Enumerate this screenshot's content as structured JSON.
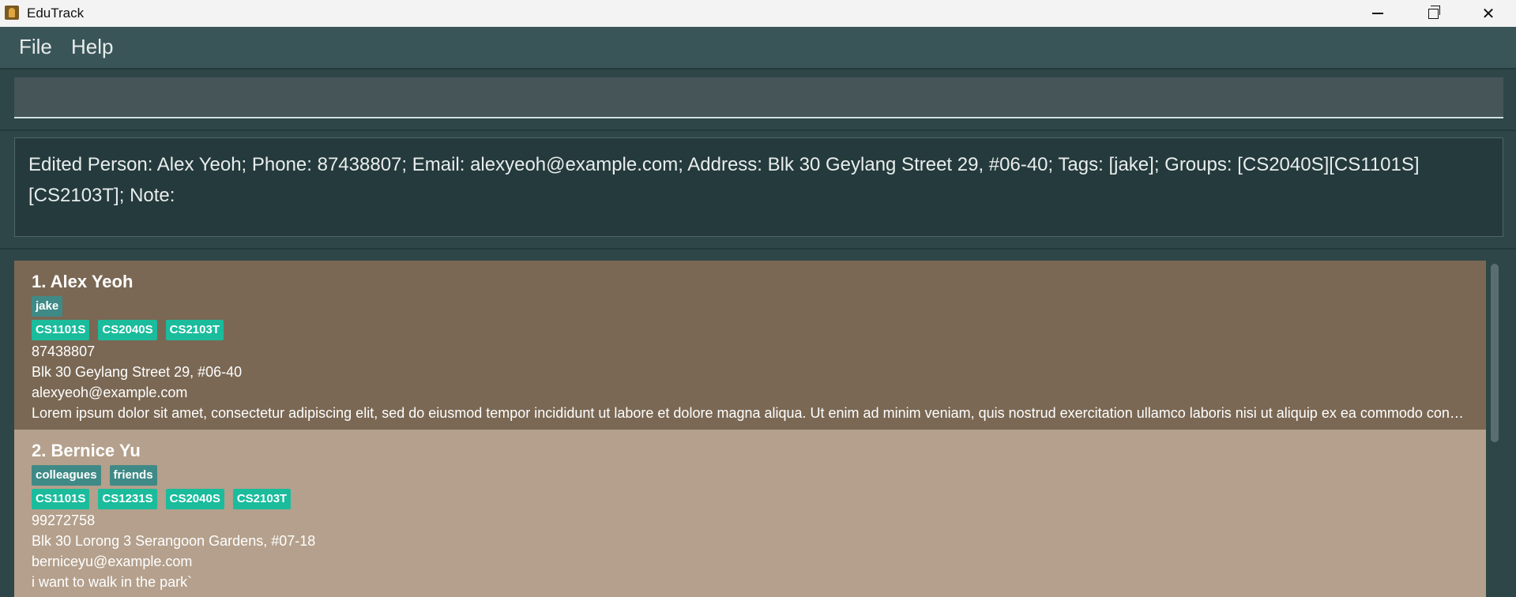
{
  "window": {
    "title": "EduTrack",
    "minimize_icon": "minimize-icon",
    "maximize_icon": "restore-icon",
    "close_icon": "close-icon",
    "close_glyph": "✕"
  },
  "menu": {
    "file": "File",
    "help": "Help"
  },
  "command_box": {
    "value": "",
    "placeholder": ""
  },
  "result_display": {
    "text": "Edited Person: Alex Yeoh; Phone: 87438807; Email: alexyeoh@example.com; Address: Blk 30 Geylang Street 29, #06-40; Tags: [jake]; Groups: [CS2040S][CS1101S][CS2103T]; Note:"
  },
  "persons": [
    {
      "name": "1. Alex Yeoh",
      "tags": [
        "jake"
      ],
      "groups": [
        "CS1101S",
        "CS2040S",
        "CS2103T"
      ],
      "phone": "87438807",
      "address": "Blk 30 Geylang Street 29, #06-40",
      "email": "alexyeoh@example.com",
      "note": "Lorem ipsum dolor sit amet, consectetur adipiscing elit, sed do eiusmod tempor incididunt ut labore et dolore magna aliqua. Ut enim ad minim veniam, quis nostrud exercitation ullamco laboris nisi ut aliquip ex ea commodo consequat."
    },
    {
      "name": "2. Bernice Yu",
      "tags": [
        "colleagues",
        "friends"
      ],
      "groups": [
        "CS1101S",
        "CS1231S",
        "CS2040S",
        "CS2103T"
      ],
      "phone": "99272758",
      "address": "Blk 30 Lorong 3 Serangoon Gardens, #07-18",
      "email": "berniceyu@example.com",
      "note": "i want to walk in the park`"
    }
  ],
  "colors": {
    "selected_card": "#7a6854",
    "card": "#b4a08c",
    "tag": "#3f8a86",
    "group": "#1abc9c"
  }
}
